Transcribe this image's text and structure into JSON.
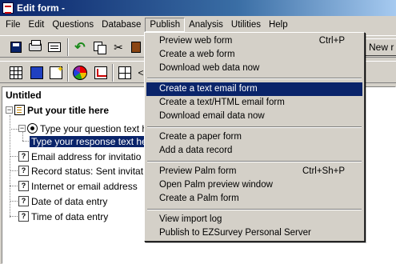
{
  "window": {
    "title": "Edit form -"
  },
  "menubar": [
    "File",
    "Edit",
    "Questions",
    "Database",
    "Publish",
    "Analysis",
    "Utilities",
    "Help"
  ],
  "toolbar": {
    "new_label": "New r"
  },
  "tree": {
    "title": "Untitled",
    "root": "Put your title here",
    "question": "Type your question text h",
    "response": "Type your response text he",
    "fields": [
      "Email address for invitatio",
      "Record status: Sent invitat",
      "Internet or email address",
      "Date of data entry",
      "Time of data entry"
    ]
  },
  "publish_menu": {
    "groups": [
      [
        {
          "label": "Preview web form",
          "shortcut": "Ctrl+P"
        },
        {
          "label": "Create a web form",
          "shortcut": ""
        },
        {
          "label": "Download web data now",
          "shortcut": ""
        }
      ],
      [
        {
          "label": "Create a text email form",
          "shortcut": ""
        },
        {
          "label": "Create a text/HTML email form",
          "shortcut": ""
        },
        {
          "label": "Download email data now",
          "shortcut": ""
        }
      ],
      [
        {
          "label": "Create a paper form",
          "shortcut": ""
        },
        {
          "label": "Add a data record",
          "shortcut": ""
        }
      ],
      [
        {
          "label": "Preview Palm form",
          "shortcut": "Ctrl+Sh+P"
        },
        {
          "label": "Open Palm preview window",
          "shortcut": ""
        },
        {
          "label": "Create a Palm form",
          "shortcut": ""
        }
      ],
      [
        {
          "label": "View import log",
          "shortcut": ""
        },
        {
          "label": "Publish to EZSurvey Personal Server",
          "shortcut": ""
        }
      ]
    ],
    "highlighted": "Create a text email form"
  },
  "colors": {
    "highlight": "#0a246a",
    "face": "#d4d0c8"
  },
  "icons": [
    "save-icon",
    "print-icon",
    "form-icon",
    "undo-icon",
    "copy-icon",
    "cut-icon",
    "paste-icon",
    "grid-icon",
    "book-icon",
    "new-item-icon",
    "pie-chart-icon",
    "report-icon",
    "frame-icon",
    "arrow-icon"
  ]
}
